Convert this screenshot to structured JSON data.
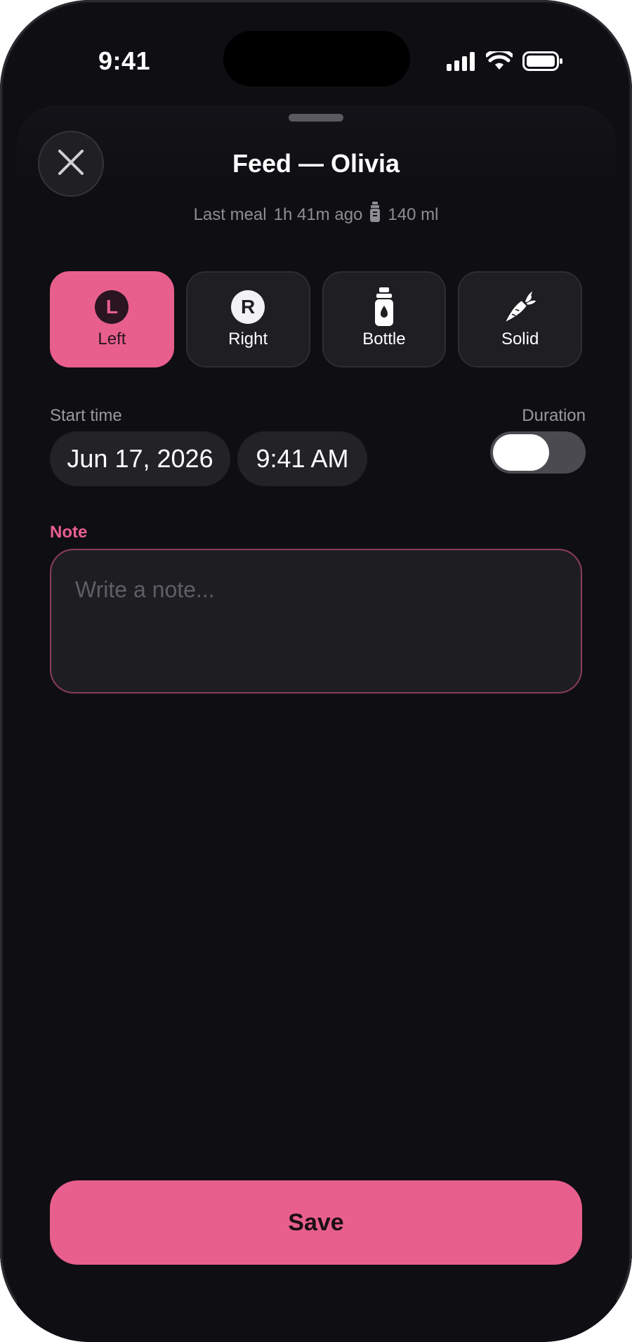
{
  "status_bar": {
    "time": "9:41"
  },
  "header": {
    "title": "Feed — Olivia",
    "last_meal_label": "Last meal",
    "last_meal_ago": "1h 41m ago",
    "last_meal_amount": "140 ml"
  },
  "feed_types": [
    {
      "label": "Left",
      "badge": "L",
      "selected": true
    },
    {
      "label": "Right",
      "badge": "R",
      "selected": false
    },
    {
      "label": "Bottle",
      "icon": "bottle-icon",
      "selected": false
    },
    {
      "label": "Solid",
      "icon": "carrot-icon",
      "selected": false
    }
  ],
  "start_time": {
    "label": "Start time",
    "date": "Jun 17, 2026",
    "time": "9:41 AM"
  },
  "duration": {
    "label": "Duration",
    "enabled": false
  },
  "note": {
    "label": "Note",
    "placeholder": "Write a note..."
  },
  "save_label": "Save",
  "colors": {
    "accent": "#e85f8d",
    "background": "#0f0e12",
    "surface": "#1f1e23"
  }
}
